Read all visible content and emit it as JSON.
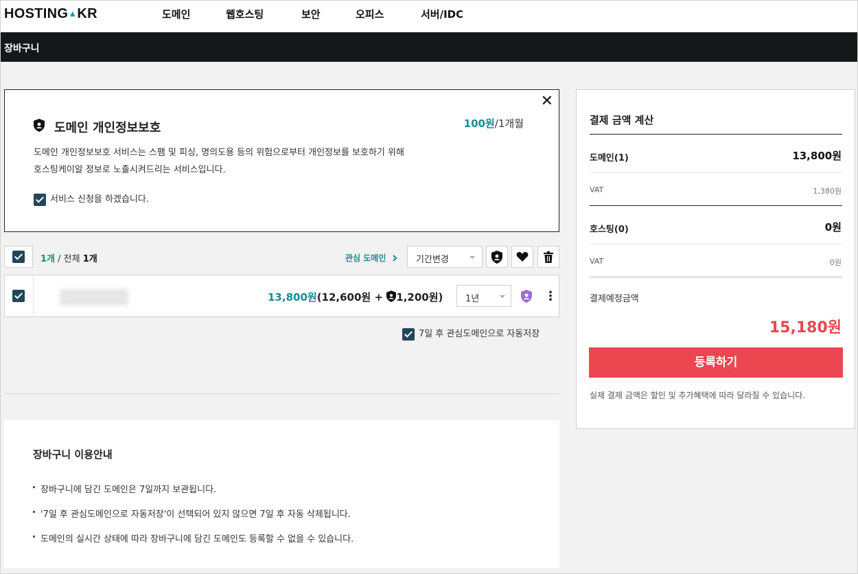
{
  "header": {
    "logo_text": "HOSTING",
    "logo_tld": "KR",
    "nav": [
      "도메인",
      "웹호스팅",
      "보안",
      "오피스",
      "서버/IDC"
    ]
  },
  "subbar": {
    "title": "장바구니"
  },
  "privacy": {
    "title": "도메인 개인정보보호",
    "price_amount": "100원",
    "price_unit": "/1개월",
    "desc_line1": "도메인 개인정보보호 서비스는 스팸 및 피싱, 명의도용 등의 위험으로부터 개인정보를 보호하기 위해",
    "desc_line2": "호스팅케이알 정보로 노출시켜드리는 서비스입니다.",
    "agree_label": "서비스 신청을 하겠습니다.",
    "agree_checked": true
  },
  "list": {
    "selected_count": "1개",
    "separator": " / ",
    "total_label": "전체",
    "total_count": "1개",
    "watch_link": "관심 도메인",
    "period_select": "기간변경"
  },
  "row": {
    "checked": true,
    "price_total": "13,800원",
    "price_open": "(12,600원",
    "plus": "+",
    "price_privacy": "1,200원)",
    "period": "1년"
  },
  "autosave": {
    "label": "7일 후 관심도메인으로 자동저장",
    "checked": true
  },
  "guide": {
    "title": "장바구니 이용안내",
    "items": [
      "장바구니에 담긴 도메인은 7일까지 보관됩니다.",
      "'7일 후 관심도메인으로 자동저장'이 선택되어 있지 않으면 7일 후 자동 삭제됩니다.",
      "도메인의 실시간 상태에 따라 장바구니에 담긴 도메인도 등록할 수 없을 수 있습니다."
    ]
  },
  "summary": {
    "title": "결제 금액 계산",
    "domain_label": "도메인(1)",
    "domain_value": "13,800원",
    "domain_vat_label": "VAT",
    "domain_vat_value": "1,380원",
    "hosting_label": "호스팅(0)",
    "hosting_value": "0원",
    "hosting_vat_label": "VAT",
    "hosting_vat_value": "0원",
    "planned_label": "결제예정금액",
    "total": "15,180원",
    "register_button": "등록하기",
    "note": "실제 결제 금액은 할인 및 추가혜택에 따라 달라질 수 있습니다."
  },
  "colors": {
    "accent_teal": "#1a8c8f",
    "total_red": "#e2494e",
    "register_red": "#ec4651",
    "header_dark": "#141819",
    "checkbox_navy": "#23465b",
    "badge_purple": "#9b6fd6"
  },
  "icons": [
    "shield-icon",
    "close-icon",
    "check-icon",
    "chevron-right-icon",
    "shield-user-icon",
    "heart-icon",
    "trash-icon",
    "more-vertical-icon"
  ]
}
